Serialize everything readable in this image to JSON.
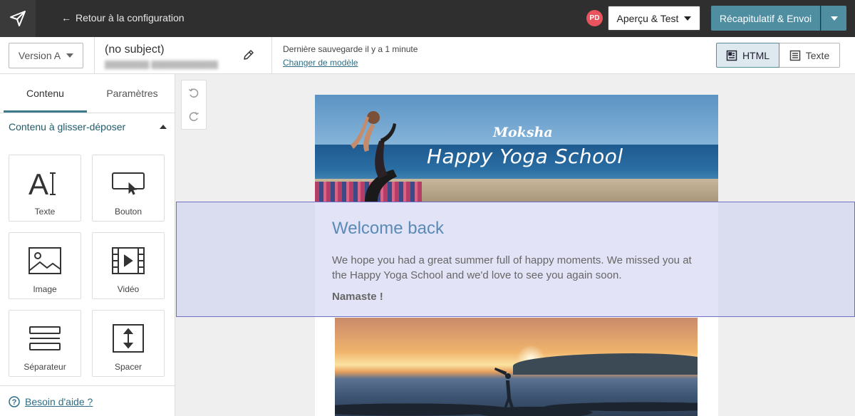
{
  "topbar": {
    "back_label": "Retour à la configuration",
    "avatar_initials": "PD",
    "preview_button": "Aperçu & Test",
    "summary_button": "Récapitulatif & Envoi"
  },
  "subbar": {
    "version_select": "Version A",
    "subject": "(no subject)",
    "save_status": "Dernière sauvegarde il y a 1 minute",
    "change_model_link": "Changer de modèle",
    "format_html": "HTML",
    "format_text": "Texte"
  },
  "sidebar": {
    "tabs": [
      {
        "label": "Contenu",
        "active": true
      },
      {
        "label": "Paramètres",
        "active": false
      }
    ],
    "section_title": "Contenu à glisser-déposer",
    "blocks": [
      {
        "label": "Texte",
        "icon": "text-icon"
      },
      {
        "label": "Bouton",
        "icon": "button-icon"
      },
      {
        "label": "Image",
        "icon": "image-icon"
      },
      {
        "label": "Vidéo",
        "icon": "video-icon"
      },
      {
        "label": "Séparateur",
        "icon": "separator-icon"
      },
      {
        "label": "Spacer",
        "icon": "spacer-icon"
      }
    ],
    "help_link": "Besoin d'aide ?"
  },
  "email": {
    "hero_brand": "Moksha",
    "hero_title": "Happy Yoga School",
    "heading": "Welcome back",
    "paragraph": "We hope you had a great summer full of happy moments. We missed you at the Happy Yoga School and we'd love to see you again soon.",
    "signoff": "Namaste !"
  },
  "colors": {
    "topbar_bg": "#2f2f2f",
    "accent": "#4f8ea1",
    "link": "#2d6e85",
    "selection_border": "#6e6ec4",
    "heading": "#5a8ab5"
  }
}
